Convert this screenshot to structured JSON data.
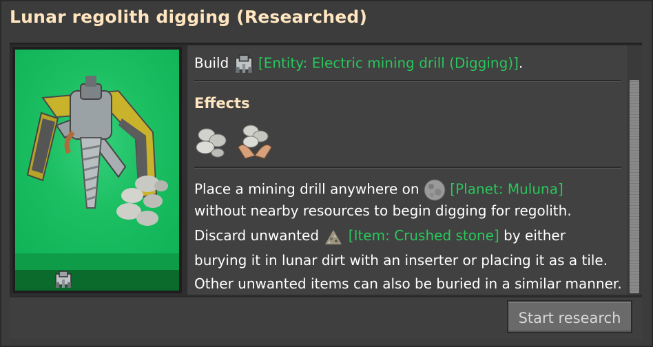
{
  "title": "Lunar regolith digging (Researched)",
  "text": {
    "build_prefix": "Build",
    "build_entity": "[Entity: Electric mining drill (Digging)]",
    "build_suffix": ".",
    "effects_heading": "Effects",
    "desc_l1_a": "Place a mining drill anywhere on",
    "desc_l1_link": "[Planet: Muluna]",
    "desc_l2": "without nearby resources to begin digging for regolith.",
    "desc_l3_a": "Discard unwanted",
    "desc_l3_link": "[Item: Crushed stone]",
    "desc_l3_b": "by either",
    "desc_l4": "burying it in lunar dirt with an inserter or placing it as a tile.",
    "desc_l5": "Other unwanted items can also be buried in a similar manner."
  },
  "button": {
    "start_research": "Start research"
  },
  "icons": [
    "mining-drill-icon",
    "rock-effect-icon",
    "rock-hands-effect-icon",
    "moon-icon",
    "crushed-stone-icon"
  ],
  "colors": {
    "title": "#ffe6c0",
    "link_green": "#29c75c",
    "card_green": "#0fb85a"
  }
}
